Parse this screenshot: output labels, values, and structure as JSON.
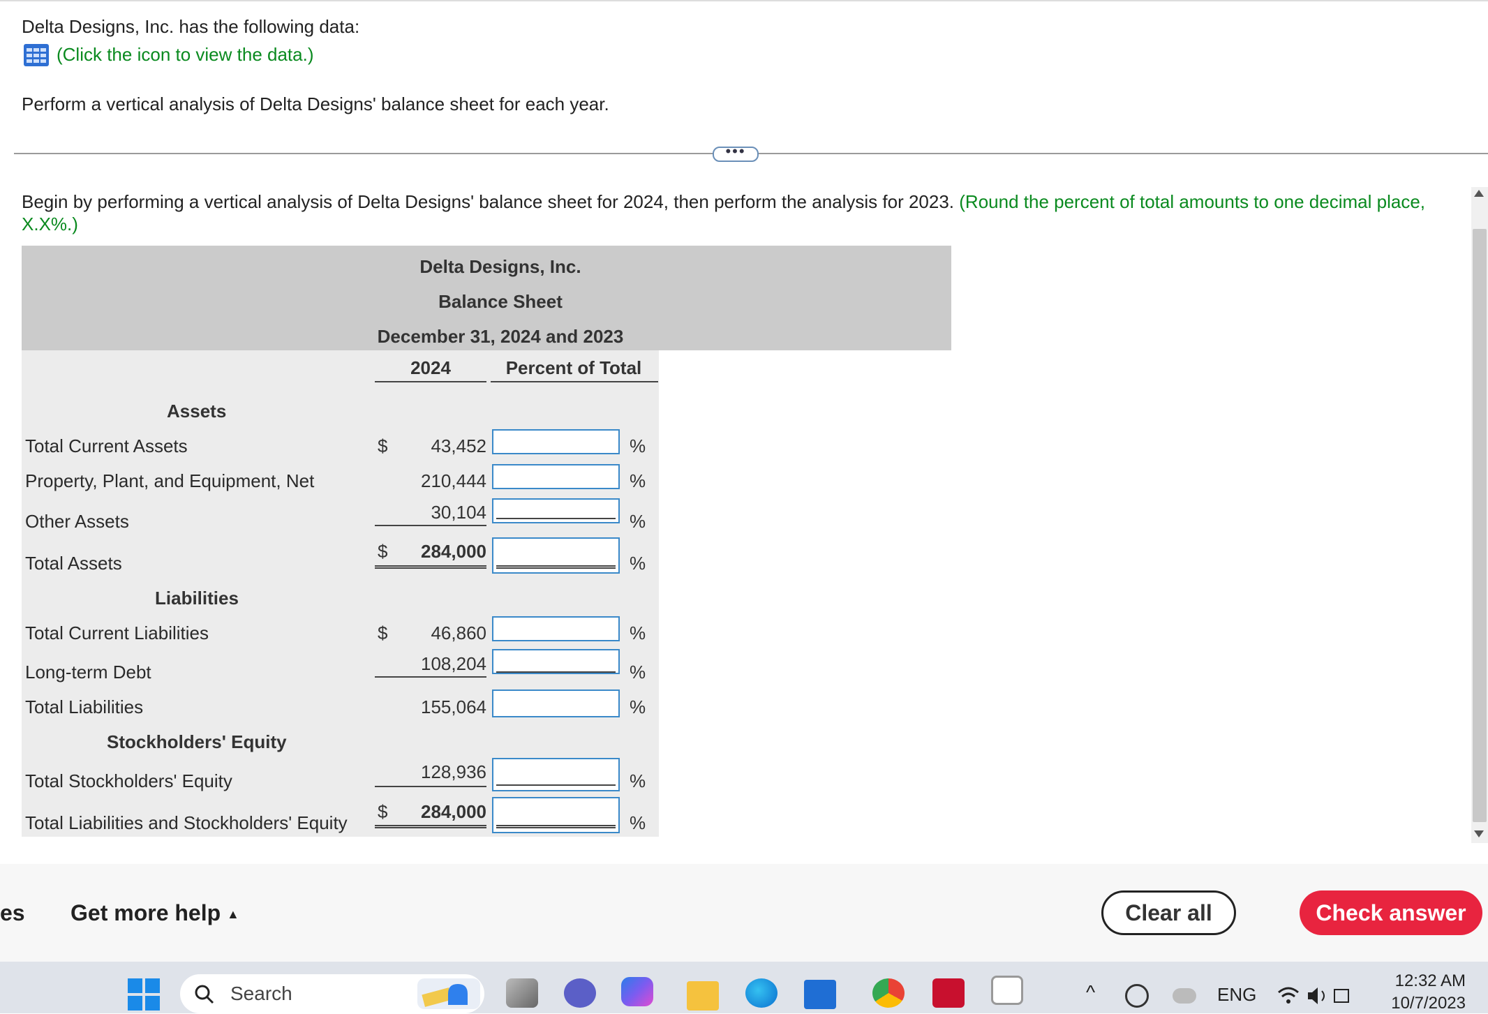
{
  "intro": {
    "line1": "Delta Designs, Inc. has the following data:",
    "link": "(Click the icon to view the data.)",
    "task": "Perform a vertical analysis of Delta Designs' balance sheet for each year."
  },
  "instruction": {
    "text": "Begin by performing a vertical analysis of Delta Designs' balance sheet for 2024, then perform the analysis for 2023.",
    "hint_line1": "(Round the percent of total amounts to one decimal place,",
    "hint_line2": "X.X%.)"
  },
  "divider_label": "•••",
  "table": {
    "company": "Delta Designs, Inc.",
    "statement": "Balance Sheet",
    "date": "December 31, 2024 and 2023",
    "col_year": "2024",
    "col_pct": "Percent of Total",
    "section_assets": "Assets",
    "section_liabilities": "Liabilities",
    "section_equity": "Stockholders' Equity",
    "currency": "$",
    "pct_sign": "%",
    "rows": [
      {
        "label": "Total Current Assets",
        "amount": "43,452",
        "percent": ""
      },
      {
        "label": "Property, Plant, and Equipment, Net",
        "amount": "210,444",
        "percent": ""
      },
      {
        "label": "Other Assets",
        "amount": "30,104",
        "percent": ""
      },
      {
        "label": "Total Assets",
        "amount": "284,000",
        "percent": ""
      },
      {
        "label": "Total Current Liabilities",
        "amount": "46,860",
        "percent": ""
      },
      {
        "label": "Long-term Debt",
        "amount": "108,204",
        "percent": ""
      },
      {
        "label": "Total Liabilities",
        "amount": "155,064",
        "percent": ""
      },
      {
        "label": "Total Stockholders' Equity",
        "amount": "128,936",
        "percent": ""
      },
      {
        "label": "Total Liabilities and Stockholders' Equity",
        "amount": "284,000",
        "percent": ""
      }
    ]
  },
  "footer": {
    "left_partial": "es",
    "help": "Get more help",
    "help_caret": "▲",
    "clear": "Clear all",
    "check": "Check answer"
  },
  "taskbar": {
    "search": "Search",
    "lang": "ENG",
    "time": "12:32 AM",
    "date": "10/7/2023",
    "chevron": "^"
  },
  "colors": {
    "link_green": "#0a8a1f",
    "input_border": "#3a89c9",
    "check_button": "#e8243f",
    "table_header_bg": "#cbcbcb",
    "table_body_bg": "#ececec"
  }
}
